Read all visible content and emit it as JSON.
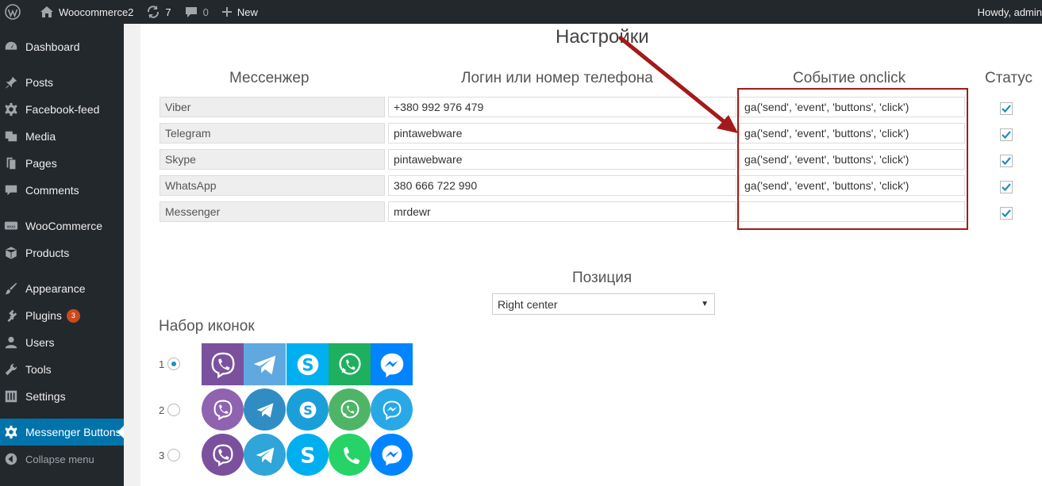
{
  "adminbar": {
    "site_name": "Woocommerce2",
    "updates_count": "7",
    "comments_count": "0",
    "new_label": "New",
    "howdy": "Howdy, admin"
  },
  "sidebar": {
    "items": [
      {
        "label": "Dashboard",
        "icon": "dashboard-icon"
      },
      {
        "label": "Posts",
        "icon": "pin-icon"
      },
      {
        "label": "Facebook-feed",
        "icon": "gear-icon"
      },
      {
        "label": "Media",
        "icon": "media-icon"
      },
      {
        "label": "Pages",
        "icon": "pages-icon"
      },
      {
        "label": "Comments",
        "icon": "comment-icon"
      },
      {
        "label": "WooCommerce",
        "icon": "woo-icon"
      },
      {
        "label": "Products",
        "icon": "box-icon"
      },
      {
        "label": "Appearance",
        "icon": "brush-icon"
      },
      {
        "label": "Plugins",
        "icon": "plug-icon",
        "badge": "3"
      },
      {
        "label": "Users",
        "icon": "user-icon"
      },
      {
        "label": "Tools",
        "icon": "wrench-icon"
      },
      {
        "label": "Settings",
        "icon": "settings-icon"
      },
      {
        "label": "Messenger Buttons",
        "icon": "gear-icon"
      },
      {
        "label": "Collapse menu",
        "icon": "collapse-icon"
      }
    ]
  },
  "main": {
    "title": "Настройки",
    "headers": {
      "messenger": "Мессенжер",
      "login": "Логин или номер телефона",
      "onclick": "Событие onclick",
      "status": "Статус"
    },
    "rows": [
      {
        "name": "Viber",
        "login": "+380 992 976 479",
        "onclick": "ga('send', 'event', 'buttons', 'click')",
        "checked": true
      },
      {
        "name": "Telegram",
        "login": "pintawebware",
        "onclick": "ga('send', 'event', 'buttons', 'click')",
        "checked": true
      },
      {
        "name": "Skype",
        "login": "pintawebware",
        "onclick": "ga('send', 'event', 'buttons', 'click')",
        "checked": true
      },
      {
        "name": "WhatsApp",
        "login": "380 666 722 990",
        "onclick": "ga('send', 'event', 'buttons', 'click')",
        "checked": true
      },
      {
        "name": "Messenger",
        "login": "mrdewr",
        "onclick": "",
        "checked": true
      }
    ],
    "position_label": "Позиция",
    "position_value": "Right center",
    "icon_set_label": "Набор иконок",
    "icon_sets": [
      {
        "number": "1",
        "selected": true,
        "shape": "square"
      },
      {
        "number": "2",
        "selected": false,
        "shape": "circle"
      },
      {
        "number": "3",
        "selected": false,
        "shape": "circle"
      }
    ]
  },
  "colors": {
    "viber": "#7b519d",
    "telegram": "#2fa5d9",
    "skype": "#00aff0",
    "whatsapp": "#25d366",
    "messenger": "#0084ff",
    "accent": "#0073aa",
    "highlight": "#a31a1a"
  }
}
